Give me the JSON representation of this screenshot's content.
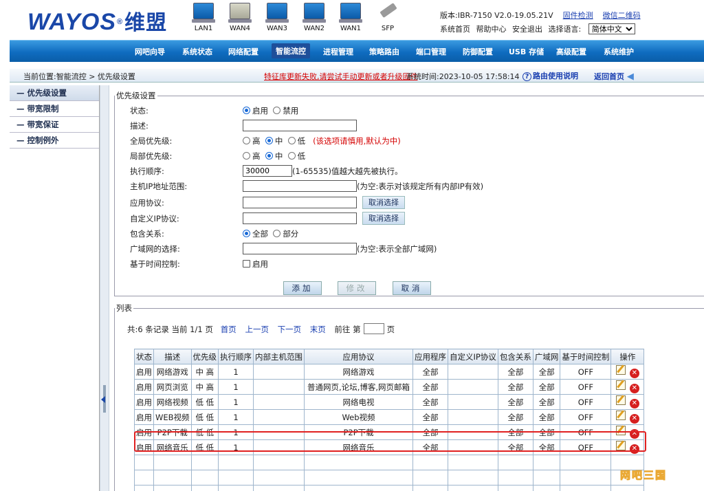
{
  "header": {
    "logo_text": "WAYOS",
    "logo_reg": "®",
    "logo_cn": "维盟",
    "ports": [
      "LAN1",
      "WAN4",
      "WAN3",
      "WAN2",
      "WAN1",
      "SFP"
    ],
    "version": "版本:IBR-7150 V2.0-19.05.21V",
    "firmware_check": "固件检测",
    "wechat_qr": "微信二维码",
    "links": [
      "系统首页",
      "帮助中心",
      "安全退出",
      "选择语言:"
    ],
    "language": "简体中文"
  },
  "nav": {
    "items": [
      "网吧向导",
      "系统状态",
      "网络配置",
      "智能流控",
      "进程管理",
      "策略路由",
      "端口管理",
      "防御配置",
      "USB 存储",
      "高级配置",
      "系统维护"
    ],
    "active": "智能流控"
  },
  "crumbbar": {
    "location": "当前位置:智能流控 > 优先级设置",
    "warning": "特征库更新失败,请尝试手动更新或者升级固件",
    "systime": "系统时间:2023-10-05 17:58:14",
    "help": "路由使用说明",
    "home": "返回首页"
  },
  "sidebar": {
    "items": [
      "优先级设置",
      "带宽限制",
      "带宽保证",
      "控制例外"
    ]
  },
  "form": {
    "legend": "优先级设置",
    "status_label": "状态:",
    "status_on": "启用",
    "status_off": "禁用",
    "desc_label": "描述:",
    "global_label": "全局优先级:",
    "high": "高",
    "mid": "中",
    "low": "低",
    "global_note": "(该选项请慎用,默认为中)",
    "local_label": "局部优先级:",
    "order_label": "执行顺序:",
    "order_value": "30000",
    "order_note": "(1-65535)值越大越先被执行。",
    "host_label": "主机IP地址范围:",
    "host_note": "(为空:表示对该规定所有内部IP有效)",
    "app_label": "应用协议:",
    "custom_label": "自定义IP协议:",
    "cancel_select": "取消选择",
    "contain_label": "包含关系:",
    "contain_all": "全部",
    "contain_part": "部分",
    "wan_label": "广域网的选择:",
    "wan_note": "(为空:表示全部广域网)",
    "time_label": "基于时间控制:",
    "time_enable": "启用",
    "btn_add": "添加",
    "btn_modify": "修改",
    "btn_cancel": "取消"
  },
  "list": {
    "legend": "列表",
    "summary": "共:6 条记录 当前 1/1 页",
    "first": "首页",
    "prev": "上一页",
    "next": "下一页",
    "last": "末页",
    "goto": "前往 第",
    "page_unit": "页",
    "columns": [
      "状态",
      "描述",
      "优先级",
      "执行顺序",
      "内部主机范围",
      "应用协议",
      "应用程序",
      "自定义IP协议",
      "包含关系",
      "广域网",
      "基于时间控制",
      "操作"
    ],
    "rows": [
      [
        "启用",
        "网络游戏",
        "中 高",
        "1",
        "",
        "网络游戏",
        "全部",
        "",
        "全部",
        "全部",
        "OFF"
      ],
      [
        "启用",
        "网页浏览",
        "中 高",
        "1",
        "",
        "普通网页,论坛,博客,网页邮箱",
        "全部",
        "",
        "全部",
        "全部",
        "OFF"
      ],
      [
        "启用",
        "网络视频",
        "低 低",
        "1",
        "",
        "网络电视",
        "全部",
        "",
        "全部",
        "全部",
        "OFF"
      ],
      [
        "启用",
        "WEB视频",
        "低 低",
        "1",
        "",
        "Web视频",
        "全部",
        "",
        "全部",
        "全部",
        "OFF"
      ],
      [
        "启用",
        "P2P下载",
        "低 低",
        "1",
        "",
        "P2P下载",
        "全部",
        "",
        "全部",
        "全部",
        "OFF"
      ],
      [
        "启用",
        "网络音乐",
        "低 低",
        "1",
        "",
        "网络音乐",
        "全部",
        "",
        "全部",
        "全部",
        "OFF"
      ]
    ]
  },
  "watermark": "网吧三国"
}
